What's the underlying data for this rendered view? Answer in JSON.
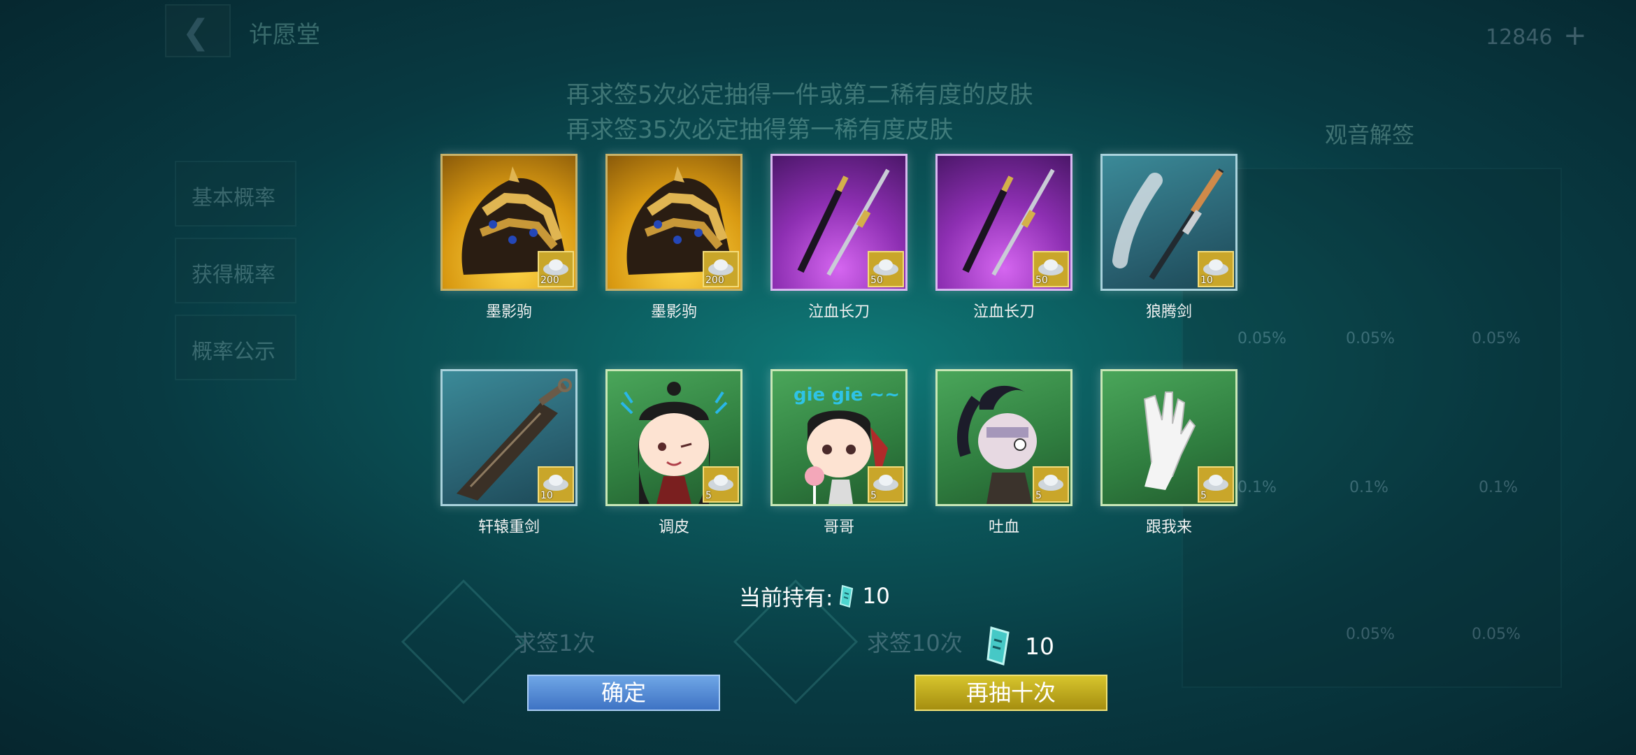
{
  "background": {
    "title": "许愿堂",
    "currency": "12846",
    "line1": "再求签5次必定抽得一件或第二稀有度的皮肤",
    "line2": "再求签35次必定抽得第一稀有度皮肤",
    "right_title": "观音解签",
    "left_tabs": [
      "基本概率",
      "获得概率",
      "概率公示"
    ],
    "btn1": "求签1次",
    "btn10": "求签10次",
    "pcts": [
      "0.05%",
      "0.05%",
      "0.05%",
      "0.1%",
      "0.1%",
      "0.1%",
      "0.05%",
      "0.05%"
    ]
  },
  "rewards": [
    {
      "name": "墨影驹",
      "count": "200",
      "rarity": "gold",
      "art": "horse-icon"
    },
    {
      "name": "墨影驹",
      "count": "200",
      "rarity": "gold",
      "art": "horse-icon"
    },
    {
      "name": "泣血长刀",
      "count": "50",
      "rarity": "purple",
      "art": "blade-icon"
    },
    {
      "name": "泣血长刀",
      "count": "50",
      "rarity": "purple",
      "art": "blade-icon"
    },
    {
      "name": "狼腾剑",
      "count": "10",
      "rarity": "teal",
      "art": "sword-icon"
    },
    {
      "name": "轩辕重剑",
      "count": "10",
      "rarity": "teal",
      "art": "greatsword-icon"
    },
    {
      "name": "调皮",
      "count": "5",
      "rarity": "green",
      "art": "emote-wink-icon"
    },
    {
      "name": "哥哥",
      "count": "5",
      "rarity": "green",
      "art": "emote-gie-icon",
      "emote_text": "gie gie ~~"
    },
    {
      "name": "吐血",
      "count": "5",
      "rarity": "green",
      "art": "emote-ponytail-icon"
    },
    {
      "name": "跟我来",
      "count": "5",
      "rarity": "green",
      "art": "emote-hand-icon"
    }
  ],
  "holding": {
    "label": "当前持有:",
    "value": "10"
  },
  "cost": {
    "value": "10"
  },
  "buttons": {
    "confirm": "确定",
    "again": "再抽十次"
  },
  "colors": {
    "confirm": "#4f86d6",
    "again": "#c7b21e",
    "gold": "#d99a12",
    "purple": "#8d2fb2",
    "teal": "#2a6272",
    "green": "#2f7d3f"
  }
}
